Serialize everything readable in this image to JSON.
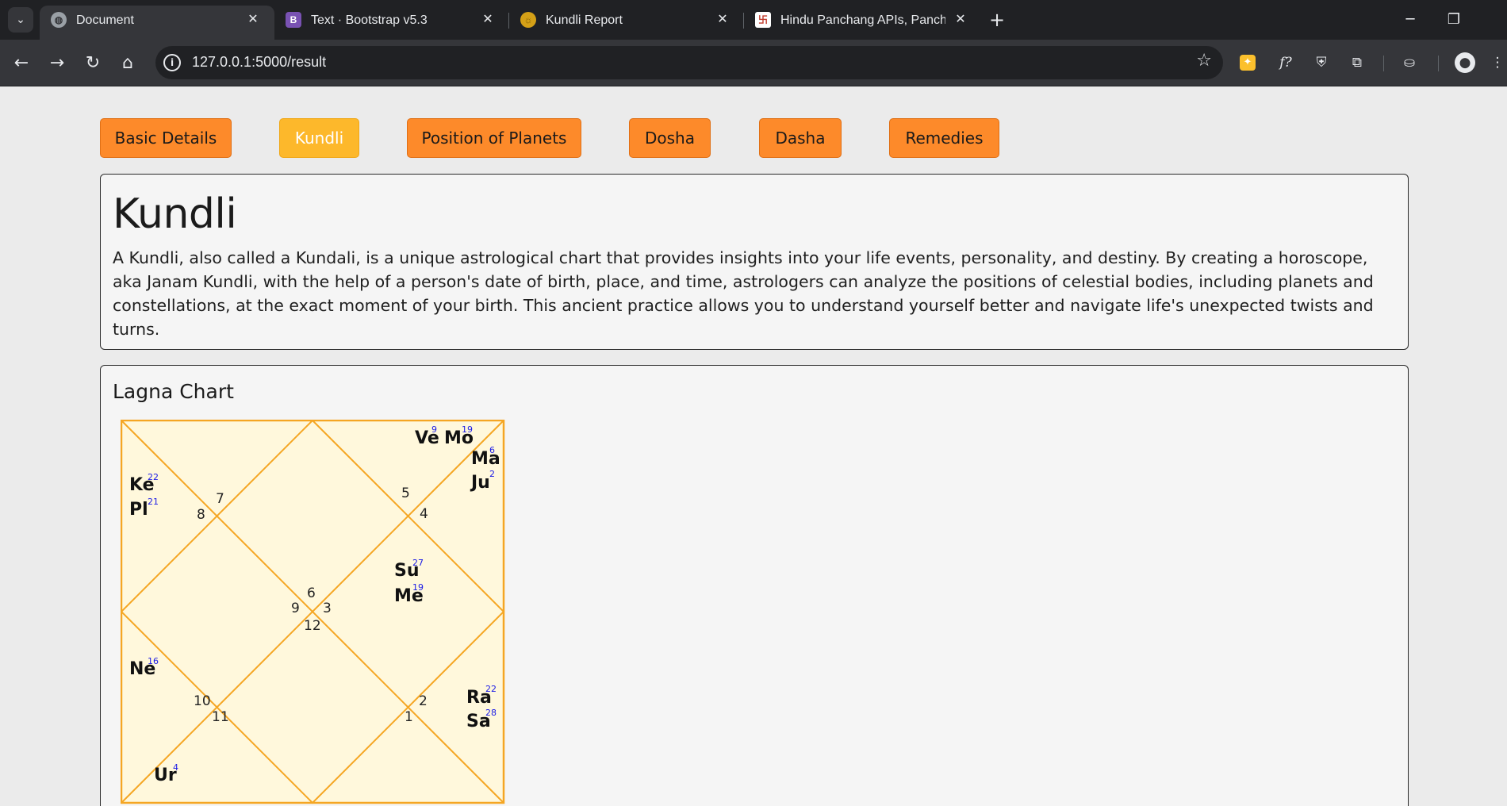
{
  "browser": {
    "tabs": [
      {
        "title": "Document",
        "favicon": "globe-icon",
        "active": true
      },
      {
        "title": "Text · Bootstrap v5.3",
        "favicon": "bootstrap-icon",
        "active": false
      },
      {
        "title": "Kundli Report",
        "favicon": "sun-icon",
        "active": false
      },
      {
        "title": "Hindu Panchang APIs, Panchang",
        "favicon": "swastik-icon",
        "active": false
      }
    ],
    "url": "127.0.0.1:5000/result"
  },
  "nav": {
    "buttons": [
      {
        "label": "Basic Details",
        "active": false
      },
      {
        "label": "Kundli",
        "active": true
      },
      {
        "label": "Position of Planets",
        "active": false
      },
      {
        "label": "Dosha",
        "active": false
      },
      {
        "label": "Dasha",
        "active": false
      },
      {
        "label": "Remedies",
        "active": false
      }
    ],
    "button_color": "#fd8a2a",
    "active_button_color": "#fdb82b"
  },
  "intro": {
    "title": "Kundli",
    "description": "A Kundli, also called a Kundali, is a unique astrological chart that provides insights into your life events, personality, and destiny. By creating a horoscope, aka Janam Kundli, with the help of a person's date of birth, place, and time, astrologers can analyze the positions of celestial bodies, including planets and constellations, at the exact moment of your birth. This ancient practice allows you to understand yourself better and navigate life's unexpected twists and turns."
  },
  "lagna_chart": {
    "title": "Lagna Chart",
    "line_color": "#f5a623",
    "fill_color": "#fff8dc",
    "sign_numbers": [
      "7",
      "8",
      "5",
      "4",
      "6",
      "9",
      "3",
      "12",
      "10",
      "11",
      "2",
      "1"
    ],
    "planets": [
      {
        "name": "Ve",
        "degree": "9"
      },
      {
        "name": "Mo",
        "degree": "19"
      },
      {
        "name": "Ma",
        "degree": "6"
      },
      {
        "name": "Ju",
        "degree": "2"
      },
      {
        "name": "Ke",
        "degree": "22"
      },
      {
        "name": "Pl",
        "degree": "21"
      },
      {
        "name": "Su",
        "degree": "27"
      },
      {
        "name": "Me",
        "degree": "19"
      },
      {
        "name": "Ne",
        "degree": "16"
      },
      {
        "name": "Ra",
        "degree": "22"
      },
      {
        "name": "Sa",
        "degree": "28"
      },
      {
        "name": "Ur",
        "degree": "4"
      }
    ]
  }
}
